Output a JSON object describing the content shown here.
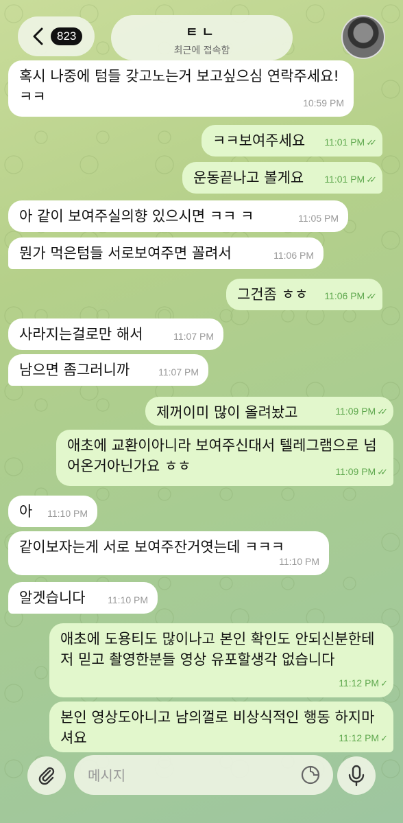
{
  "header": {
    "unread_count": "823",
    "chat_name": "ㅌㄴ",
    "chat_status": "최근에 접속함"
  },
  "messages": [
    {
      "dir": "in",
      "text": "혹시 나중에 텀들 갖고노는거 보고싶으심 연락주세요! ㅋㅋ",
      "time": "10:59 PM"
    },
    {
      "dir": "out",
      "text": "ㅋㅋ보여주세요",
      "time": "11:01 PM",
      "read": "✓✓"
    },
    {
      "dir": "out",
      "text": "운동끝나고 볼게요",
      "time": "11:01 PM",
      "read": "✓✓"
    },
    {
      "dir": "in",
      "text": "아 같이 보여주실의향 있으시면 ㅋㅋ ㅋ",
      "time": "11:05 PM"
    },
    {
      "dir": "in",
      "text": "뭔가 먹은텀들 서로보여주면 꼴려서",
      "time": "11:06 PM"
    },
    {
      "dir": "out",
      "text": "그건좀 ㅎㅎ",
      "time": "11:06 PM",
      "read": "✓✓"
    },
    {
      "dir": "in",
      "text": "사라지는걸로만 해서",
      "time": "11:07 PM"
    },
    {
      "dir": "in",
      "text": "남으면 좀그러니까",
      "time": "11:07 PM"
    },
    {
      "dir": "out",
      "text": "제꺼이미 많이 올려놨고",
      "time": "11:09 PM",
      "read": "✓✓"
    },
    {
      "dir": "out",
      "text": "애초에 교환이아니라 보여주신대서 텔레그램으로 넘어온거아닌가요 ㅎㅎ",
      "time": "11:09 PM",
      "read": "✓✓"
    },
    {
      "dir": "in",
      "text": "아",
      "time": "11:10 PM"
    },
    {
      "dir": "in",
      "text": "같이보자는게 서로 보여주잔거엿는데 ㅋㅋㅋ",
      "time": "11:10 PM"
    },
    {
      "dir": "in",
      "text": "알겟습니다",
      "time": "11:10 PM"
    },
    {
      "dir": "out",
      "text": "애초에 도용티도 많이나고 본인 확인도 안되신분한테 저 믿고 촬영한분들 영상 유포할생각 없습니다",
      "time": "11:12 PM",
      "read": "✓"
    },
    {
      "dir": "out",
      "text": "본인 영상도아니고 남의껄로 비상식적인 행동 하지마셔요",
      "time": "11:12 PM",
      "read": "✓"
    }
  ],
  "composer": {
    "placeholder": "메시지"
  },
  "colors": {
    "incoming_bubble": "#ffffff",
    "outgoing_bubble": "#e2f7cc",
    "read_check": "#5fa84e"
  }
}
